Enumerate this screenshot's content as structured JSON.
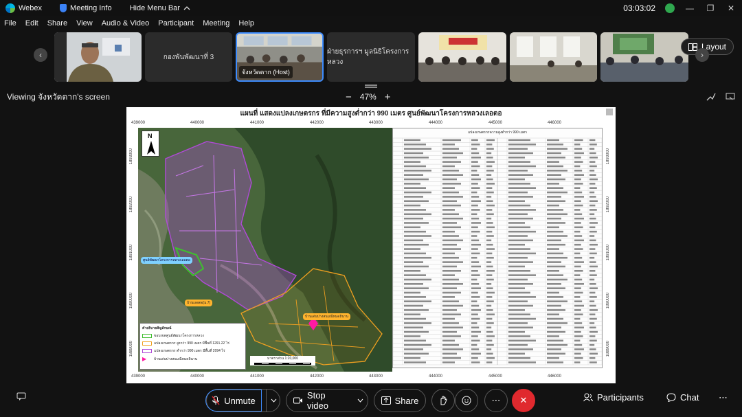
{
  "titlebar": {
    "app_name": "Webex",
    "meeting_info": "Meeting Info",
    "hide_menu": "Hide Menu Bar",
    "timer": "03:03:02",
    "min": "—",
    "max": "❐",
    "close": "✕"
  },
  "menu": [
    "File",
    "Edit",
    "Share",
    "View",
    "Audio & Video",
    "Participant",
    "Meeting",
    "Help"
  ],
  "strip": {
    "tile_names": [
      "กองพันพัฒนาที่ 3",
      "ฝ่ายธุรการฯ มูลนิธิโครงการหลวง"
    ],
    "host_label": "จังหวัดตาก (Host)",
    "layout_label": "Layout",
    "prev": "‹",
    "next": "›"
  },
  "view": {
    "viewing": "Viewing จังหวัดตาก's screen",
    "zoom_minus": "−",
    "zoom_value": "47%",
    "zoom_plus": "+"
  },
  "map": {
    "title": "แผนที่ แสดงแปลงเกษตรกร ที่มีความสูงต่ำกว่า 990 เมตร ศูนย์พัฒนาโครงการหลวงเลอตอ",
    "x_ticks": [
      "439000",
      "440000",
      "441000",
      "442000",
      "443000",
      "444000",
      "445000",
      "446000"
    ],
    "y_ticks": [
      "1893000",
      "1892000",
      "1891000",
      "1890000",
      "1889000"
    ],
    "north": "N",
    "label_center": "ศูนย์พัฒนาโครงการหลวงเลอตอ",
    "label_village1": "บ้านเลอตอ(ม.7)",
    "label_village2": "บ้านเด่นปางสนมณีหมดถินาน",
    "legend_title": "คำอธิบายสัญลักษณ์",
    "legend_items": [
      "ขอบเขตศูนย์พัฒนาโครงการหลวง",
      "แปลงเกษตรกร สูงกว่า 990 เมตร มีพื้นที่ 1291.22 ไร่",
      "แปลงเกษตรกร ต่ำกว่า 990 เมตร มีพื้นที่ 2094 ไร่",
      "บ้านเด่นปางสนมณีหมดถินาน"
    ],
    "scale": "มาตราส่วน 1:20,000",
    "table_title": "แปลงเกษตรกรความสูงต่ำกว่า 990 เมตร"
  },
  "controls": {
    "chat_left_icon": "💬",
    "unmute": "Unmute",
    "stop_video": "Stop video",
    "share": "Share",
    "participants": "Participants",
    "chat": "Chat",
    "more": "⋯",
    "end": "✕"
  },
  "colors": {
    "accent_blue": "#3d8cff",
    "end_red": "#e0292e",
    "boundary_green": "#3fbf2f",
    "plot_purple": "#b04ad8",
    "plot_orange": "#f0a020"
  }
}
